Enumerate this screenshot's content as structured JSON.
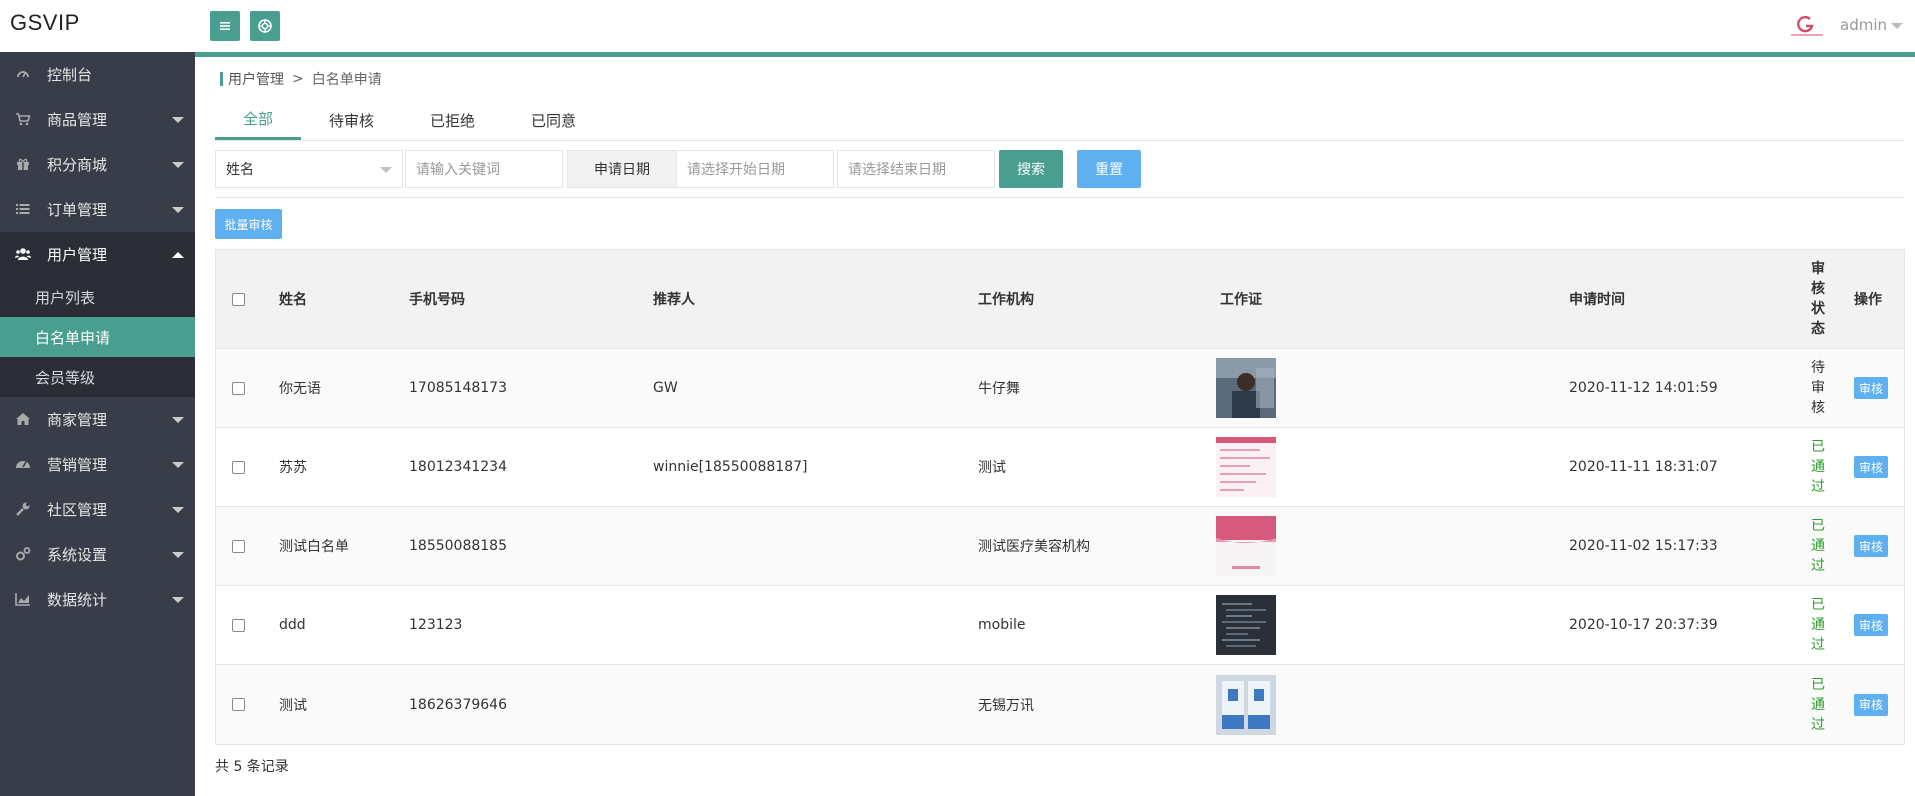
{
  "app": {
    "logo": "GSVIP",
    "user": "admin"
  },
  "breadcrumb": {
    "parent": "用户管理",
    "separator": ">",
    "current": "白名单申请"
  },
  "sidebar": {
    "items": [
      {
        "label": "控制台",
        "icon": "dashboard-icon"
      },
      {
        "label": "商品管理",
        "icon": "cart-icon"
      },
      {
        "label": "积分商城",
        "icon": "gift-icon"
      },
      {
        "label": "订单管理",
        "icon": "list-icon"
      },
      {
        "label": "用户管理",
        "icon": "users-icon"
      },
      {
        "label": "商家管理",
        "icon": "home-icon"
      },
      {
        "label": "营销管理",
        "icon": "gauge-icon"
      },
      {
        "label": "社区管理",
        "icon": "wrench-icon"
      },
      {
        "label": "系统设置",
        "icon": "gears-icon"
      },
      {
        "label": "数据统计",
        "icon": "chart-icon"
      }
    ],
    "sub_items": [
      "用户列表",
      "白名单申请",
      "会员等级"
    ]
  },
  "tabs": [
    "全部",
    "待审核",
    "已拒绝",
    "已同意"
  ],
  "filters": {
    "field_select": "姓名",
    "keyword_placeholder": "请输入关键词",
    "date_label": "申请日期",
    "start_placeholder": "请选择开始日期",
    "end_placeholder": "请选择结束日期",
    "search_label": "搜索",
    "reset_label": "重置",
    "batch_label": "批量审核"
  },
  "table": {
    "headers": {
      "name": "姓名",
      "phone": "手机号码",
      "referrer": "推荐人",
      "org": "工作机构",
      "badge": "工作证",
      "time": "申请时间",
      "status": "审核状态",
      "action": "操作"
    },
    "rows": [
      {
        "name": "你无语",
        "phone": "17085148173",
        "referrer": "GW",
        "org": "牛仔舞",
        "time": "2020-11-12 14:01:59",
        "status": "待审核",
        "status_type": "pending",
        "action": "审核",
        "thumb": "photo-person"
      },
      {
        "name": "苏苏",
        "phone": "18012341234",
        "referrer": "winnie[18550088187]",
        "org": "测试",
        "time": "2020-11-11 18:31:07",
        "status": "已通过",
        "status_type": "pass",
        "action": "审核",
        "thumb": "doc-pink"
      },
      {
        "name": "测试白名单",
        "phone": "18550088185",
        "referrer": "",
        "org": "测试医疗美容机构",
        "time": "2020-11-02 15:17:33",
        "status": "已通过",
        "status_type": "pass",
        "action": "审核",
        "thumb": "banner-pink"
      },
      {
        "name": "ddd",
        "phone": "123123",
        "referrer": "",
        "org": "mobile",
        "time": "2020-10-17 20:37:39",
        "status": "已通过",
        "status_type": "pass",
        "action": "审核",
        "thumb": "code-dark"
      },
      {
        "name": "测试",
        "phone": "18626379646",
        "referrer": "",
        "org": "无锡万讯",
        "time": "",
        "status": "已通过",
        "status_type": "pass",
        "action": "审核",
        "thumb": "cards-blue"
      }
    ]
  },
  "footer": {
    "total": "共 5 条记录"
  },
  "colors": {
    "accent": "#4a9e90",
    "sidebar": "#393d49",
    "blue_button": "#5fb0f0",
    "pass_green": "#2e9e2e"
  }
}
